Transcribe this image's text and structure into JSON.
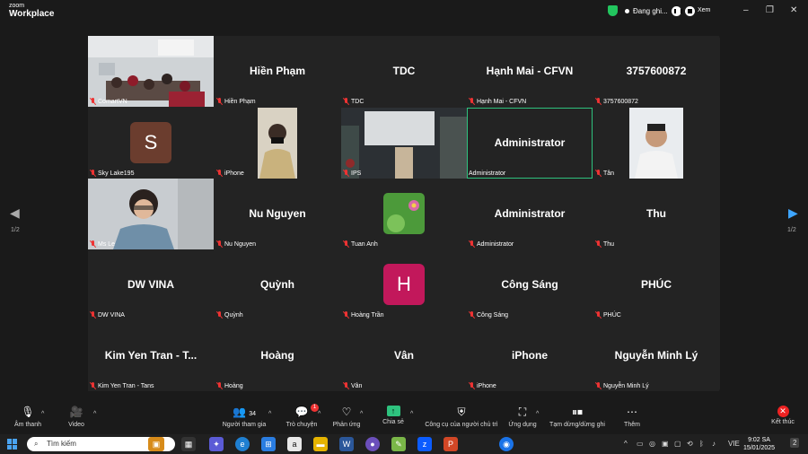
{
  "app": {
    "logo_line1": "zoom",
    "logo_line2": "Workplace"
  },
  "recording": {
    "label": "Đang ghi...",
    "view_label": "Xem"
  },
  "window_controls": {
    "minimize": "–",
    "restore": "❐",
    "close": "✕"
  },
  "pager": {
    "left": "1/2",
    "right": "1/2",
    "prev": "◀",
    "next": "▶"
  },
  "tiles": [
    {
      "big": "",
      "label": "ComartVN"
    },
    {
      "big": "Hiền Phạm",
      "label": "Hiền Phạm"
    },
    {
      "big": "TDC",
      "label": "TDC"
    },
    {
      "big": "Hạnh Mai - CFVN",
      "label": "Hạnh Mai - CFVN"
    },
    {
      "big": "3757600872",
      "label": "3757600872"
    },
    {
      "big": "",
      "label": "Sky Lake195",
      "avatar": "S"
    },
    {
      "big": "",
      "label": "iPhone"
    },
    {
      "big": "",
      "label": "IPS"
    },
    {
      "big": "Administrator",
      "label": "Administrator"
    },
    {
      "big": "",
      "label": "Tân"
    },
    {
      "big": "",
      "label": "Ms Le"
    },
    {
      "big": "Nu Nguyen",
      "label": "Nu Nguyen"
    },
    {
      "big": "",
      "label": "Tuan Anh"
    },
    {
      "big": "Administrator",
      "label": "Administrator"
    },
    {
      "big": "Thu",
      "label": "Thu"
    },
    {
      "big": "DW VINA",
      "label": "DW VINA"
    },
    {
      "big": "Quỳnh",
      "label": "Quỳnh"
    },
    {
      "big": "",
      "label": "Hoàng Trần",
      "avatar": "H"
    },
    {
      "big": "Công Sáng",
      "label": "Công Sáng"
    },
    {
      "big": "PHÚC",
      "label": "PHÚC"
    },
    {
      "big": "Kim Yen Tran - T...",
      "label": "Kim Yen Tran - Tans"
    },
    {
      "big": "Hoàng",
      "label": "Hoàng"
    },
    {
      "big": "Vân",
      "label": "Vân"
    },
    {
      "big": "iPhone",
      "label": "iPhone"
    },
    {
      "big": "Nguyễn Minh Lý",
      "label": "Nguyễn Minh Lý"
    }
  ],
  "toolbar": {
    "audio": "Âm thanh",
    "video": "Video",
    "participants": "Người tham gia",
    "participants_count": "34",
    "chat": "Trò chuyện",
    "chat_badge": "1",
    "react": "Phản ứng",
    "share": "Chia sẻ",
    "host_tools": "Công cụ của người chủ trì",
    "apps": "Ứng dụng",
    "pause_stop": "Tạm dừng/dừng ghi",
    "more": "Thêm",
    "end": "Kết thúc"
  },
  "taskbar": {
    "search_placeholder": "Tìm kiếm",
    "lang": "VIE",
    "time": "9:02 SA",
    "date": "15/01/2025",
    "notif": "2"
  },
  "colors": {
    "accent_green": "#2ec27e",
    "end_red": "#e22",
    "avatar_s": "#6b3d2e",
    "avatar_h": "#c2185b"
  }
}
